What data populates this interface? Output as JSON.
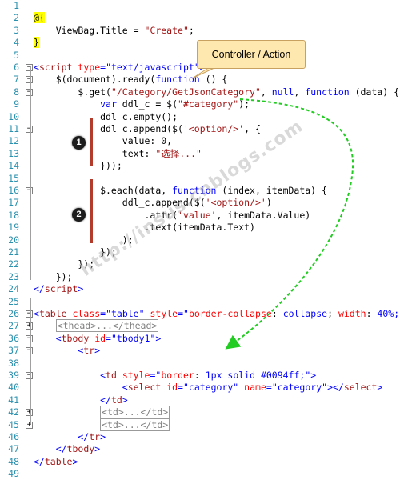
{
  "callout": {
    "text": "Controller / Action"
  },
  "badges": [
    "1",
    "2"
  ],
  "watermark": "http://insus.cnblogs.com",
  "colors": {
    "arrow": "#22cc22",
    "callout_fill": "#ffe8b0",
    "bar": "#b23b2c"
  },
  "lines": [
    {
      "n": "1",
      "segs": []
    },
    {
      "n": "2",
      "segs": [
        {
          "t": "@{",
          "c": "razor"
        }
      ]
    },
    {
      "n": "3",
      "segs": [
        {
          "t": "    ViewBag.Title = ",
          "c": "txt"
        },
        {
          "t": "\"Create\"",
          "c": "str"
        },
        {
          "t": ";",
          "c": "txt"
        }
      ]
    },
    {
      "n": "4",
      "segs": [
        {
          "t": "}",
          "c": "razor"
        }
      ]
    },
    {
      "n": "5",
      "segs": []
    },
    {
      "n": "6",
      "fold": "−",
      "segs": [
        {
          "t": "<",
          "c": "tag"
        },
        {
          "t": "script",
          "c": "tname"
        },
        {
          "t": " ",
          "c": "txt"
        },
        {
          "t": "type",
          "c": "attr"
        },
        {
          "t": "=",
          "c": "tag"
        },
        {
          "t": "\"text/javascript\"",
          "c": "attrv"
        },
        {
          "t": ">",
          "c": "tag"
        }
      ]
    },
    {
      "n": "7",
      "fold": "−",
      "segs": [
        {
          "t": "    $(document).ready(",
          "c": "txt"
        },
        {
          "t": "function",
          "c": "kw"
        },
        {
          "t": " () {",
          "c": "txt"
        }
      ]
    },
    {
      "n": "8",
      "fold": "−",
      "segs": [
        {
          "t": "        $.get(",
          "c": "txt"
        },
        {
          "t": "\"/Category/GetJsonCategory\"",
          "c": "str"
        },
        {
          "t": ", ",
          "c": "txt"
        },
        {
          "t": "null",
          "c": "kw"
        },
        {
          "t": ", ",
          "c": "txt"
        },
        {
          "t": "function",
          "c": "kw"
        },
        {
          "t": " (data) {",
          "c": "txt"
        }
      ]
    },
    {
      "n": "9",
      "segs": [
        {
          "t": "            ",
          "c": "txt"
        },
        {
          "t": "var",
          "c": "kw"
        },
        {
          "t": " ddl_c = $(",
          "c": "txt"
        },
        {
          "t": "\"#category\"",
          "c": "str"
        },
        {
          "t": ");",
          "c": "txt"
        }
      ]
    },
    {
      "n": "10",
      "segs": [
        {
          "t": "            ddl_c.empty();",
          "c": "txt"
        }
      ]
    },
    {
      "n": "11",
      "fold": "−",
      "segs": [
        {
          "t": "            ddl_c.append($(",
          "c": "txt"
        },
        {
          "t": "'<option/>'",
          "c": "str"
        },
        {
          "t": ", {",
          "c": "txt"
        }
      ]
    },
    {
      "n": "12",
      "segs": [
        {
          "t": "                value: 0,",
          "c": "txt"
        }
      ]
    },
    {
      "n": "13",
      "segs": [
        {
          "t": "                text: ",
          "c": "txt"
        },
        {
          "t": "\"选择...\"",
          "c": "str"
        }
      ]
    },
    {
      "n": "14",
      "segs": [
        {
          "t": "            }));",
          "c": "txt"
        }
      ]
    },
    {
      "n": "15",
      "segs": []
    },
    {
      "n": "16",
      "fold": "−",
      "segs": [
        {
          "t": "            $.each(data, ",
          "c": "txt"
        },
        {
          "t": "function",
          "c": "kw"
        },
        {
          "t": " (index, itemData) {",
          "c": "txt"
        }
      ]
    },
    {
      "n": "17",
      "segs": [
        {
          "t": "                ddl_c.append($(",
          "c": "txt"
        },
        {
          "t": "'<option/>'",
          "c": "str"
        },
        {
          "t": ")",
          "c": "txt"
        }
      ]
    },
    {
      "n": "18",
      "segs": [
        {
          "t": "                    .attr(",
          "c": "txt"
        },
        {
          "t": "'value'",
          "c": "str"
        },
        {
          "t": ", itemData.Value)",
          "c": "txt"
        }
      ]
    },
    {
      "n": "19",
      "segs": [
        {
          "t": "                    .text(itemData.Text)",
          "c": "txt"
        }
      ]
    },
    {
      "n": "20",
      "segs": [
        {
          "t": "                );",
          "c": "txt"
        }
      ]
    },
    {
      "n": "21",
      "segs": [
        {
          "t": "            });",
          "c": "txt"
        }
      ]
    },
    {
      "n": "22",
      "segs": [
        {
          "t": "        });",
          "c": "txt"
        }
      ]
    },
    {
      "n": "23",
      "segs": [
        {
          "t": "    });",
          "c": "txt"
        }
      ]
    },
    {
      "n": "24",
      "segs": [
        {
          "t": "</",
          "c": "tag"
        },
        {
          "t": "script",
          "c": "tname"
        },
        {
          "t": ">",
          "c": "tag"
        }
      ]
    },
    {
      "n": "25",
      "segs": []
    },
    {
      "n": "26",
      "fold": "−",
      "segs": [
        {
          "t": "<",
          "c": "tag"
        },
        {
          "t": "table",
          "c": "tname"
        },
        {
          "t": " ",
          "c": "txt"
        },
        {
          "t": "class",
          "c": "attr"
        },
        {
          "t": "=",
          "c": "tag"
        },
        {
          "t": "\"table\"",
          "c": "attrv"
        },
        {
          "t": " ",
          "c": "txt"
        },
        {
          "t": "style",
          "c": "attr"
        },
        {
          "t": "=",
          "c": "tag"
        },
        {
          "t": "\"",
          "c": "attrv"
        },
        {
          "t": "border-collapse",
          "c": "attr"
        },
        {
          "t": ": ",
          "c": "txt"
        },
        {
          "t": "collapse",
          "c": "attrv"
        },
        {
          "t": "; ",
          "c": "txt"
        },
        {
          "t": "width",
          "c": "attr"
        },
        {
          "t": ": ",
          "c": "txt"
        },
        {
          "t": "40%",
          "c": "attrv"
        },
        {
          "t": ";\"",
          "c": "attrv"
        },
        {
          "t": ">",
          "c": "tag"
        }
      ]
    },
    {
      "n": "27",
      "fold": "+",
      "segs": [
        {
          "t": "    ",
          "c": "txt"
        },
        {
          "t": "<thead>...</thead>",
          "c": "collapsed-box"
        }
      ]
    },
    {
      "n": "36",
      "fold": "−",
      "segs": [
        {
          "t": "    <",
          "c": "tag"
        },
        {
          "t": "tbody",
          "c": "tname"
        },
        {
          "t": " ",
          "c": "txt"
        },
        {
          "t": "id",
          "c": "attr"
        },
        {
          "t": "=",
          "c": "tag"
        },
        {
          "t": "\"tbody1\"",
          "c": "attrv"
        },
        {
          "t": ">",
          "c": "tag"
        }
      ]
    },
    {
      "n": "37",
      "fold": "−",
      "segs": [
        {
          "t": "        <",
          "c": "tag"
        },
        {
          "t": "tr",
          "c": "tname"
        },
        {
          "t": ">",
          "c": "tag"
        }
      ]
    },
    {
      "n": "38",
      "segs": []
    },
    {
      "n": "39",
      "fold": "−",
      "segs": [
        {
          "t": "            <",
          "c": "tag"
        },
        {
          "t": "td",
          "c": "tname"
        },
        {
          "t": " ",
          "c": "txt"
        },
        {
          "t": "style",
          "c": "attr"
        },
        {
          "t": "=",
          "c": "tag"
        },
        {
          "t": "\"",
          "c": "attrv"
        },
        {
          "t": "border",
          "c": "attr"
        },
        {
          "t": ": ",
          "c": "txt"
        },
        {
          "t": "1px solid #0094ff",
          "c": "attrv"
        },
        {
          "t": ";\"",
          "c": "attrv"
        },
        {
          "t": ">",
          "c": "tag"
        }
      ]
    },
    {
      "n": "40",
      "segs": [
        {
          "t": "                <",
          "c": "tag"
        },
        {
          "t": "select",
          "c": "tname"
        },
        {
          "t": " ",
          "c": "txt"
        },
        {
          "t": "id",
          "c": "attr"
        },
        {
          "t": "=",
          "c": "tag"
        },
        {
          "t": "\"category\"",
          "c": "attrv"
        },
        {
          "t": " ",
          "c": "txt"
        },
        {
          "t": "name",
          "c": "attr"
        },
        {
          "t": "=",
          "c": "tag"
        },
        {
          "t": "\"category\"",
          "c": "attrv"
        },
        {
          "t": "></",
          "c": "tag"
        },
        {
          "t": "select",
          "c": "tname"
        },
        {
          "t": ">",
          "c": "tag"
        }
      ]
    },
    {
      "n": "41",
      "segs": [
        {
          "t": "            </",
          "c": "tag"
        },
        {
          "t": "td",
          "c": "tname"
        },
        {
          "t": ">",
          "c": "tag"
        }
      ]
    },
    {
      "n": "42",
      "fold": "+",
      "segs": [
        {
          "t": "            ",
          "c": "txt"
        },
        {
          "t": "<td>...</td>",
          "c": "collapsed-box"
        }
      ]
    },
    {
      "n": "45",
      "fold": "+",
      "segs": [
        {
          "t": "            ",
          "c": "txt"
        },
        {
          "t": "<td>...</td>",
          "c": "collapsed-box"
        }
      ]
    },
    {
      "n": "46",
      "segs": [
        {
          "t": "        </",
          "c": "tag"
        },
        {
          "t": "tr",
          "c": "tname"
        },
        {
          "t": ">",
          "c": "tag"
        }
      ]
    },
    {
      "n": "47",
      "segs": [
        {
          "t": "    </",
          "c": "tag"
        },
        {
          "t": "tbody",
          "c": "tname"
        },
        {
          "t": ">",
          "c": "tag"
        }
      ]
    },
    {
      "n": "48",
      "segs": [
        {
          "t": "</",
          "c": "tag"
        },
        {
          "t": "table",
          "c": "tname"
        },
        {
          "t": ">",
          "c": "tag"
        }
      ]
    },
    {
      "n": "49",
      "segs": []
    }
  ]
}
